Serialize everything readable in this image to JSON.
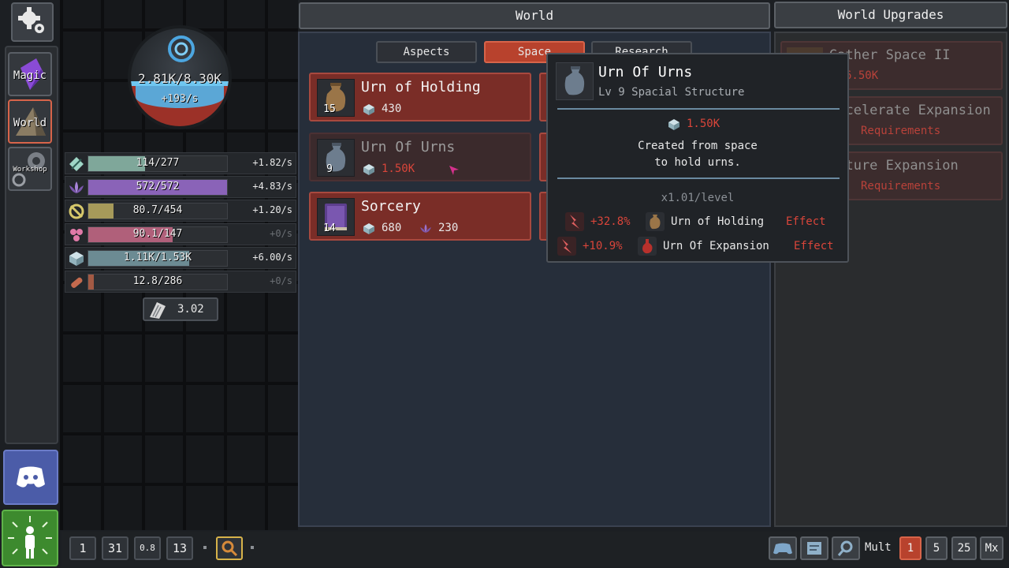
{
  "sidebar": {
    "magic_label": "Magic",
    "world_label": "World",
    "workshop_label": "Workshop"
  },
  "orb": {
    "value": "2.81K/8.30K",
    "rate": "+193/s"
  },
  "resources": [
    {
      "icon": "leaf-icon",
      "value": "114/277",
      "rate": "+1.82/s",
      "fill": 0.41,
      "color": "#7fa79a"
    },
    {
      "icon": "lotus-icon",
      "value": "572/572",
      "rate": "+4.83/s",
      "fill": 1.0,
      "color": "#8a63b8"
    },
    {
      "icon": "swirl-icon",
      "value": "80.7/454",
      "rate": "+1.20/s",
      "fill": 0.18,
      "color": "#a69a5a"
    },
    {
      "icon": "heart-icon",
      "value": "90.1/147",
      "rate": "+0/s",
      "fill": 0.61,
      "color": "#b0607a"
    },
    {
      "icon": "cube-icon",
      "value": "1.11K/1.53K",
      "rate": "+6.00/s",
      "fill": 0.73,
      "color": "#6c8b93"
    },
    {
      "icon": "log-icon",
      "value": "12.8/286",
      "rate": "+0/s",
      "fill": 0.04,
      "color": "#a35a44"
    }
  ],
  "scroll_count": "3.02",
  "headers": {
    "world": "World",
    "upgrades": "World Upgrades"
  },
  "tabs": [
    "Aspects",
    "Space",
    "Research"
  ],
  "cards": [
    {
      "name": "Urn of Holding",
      "level": "15",
      "cost": "430"
    },
    {
      "name": "Urn Of Urns",
      "level": "9",
      "cost": "1.50K"
    },
    {
      "name": "Sorcery",
      "level": "14",
      "cost": "680",
      "cost2": "230"
    }
  ],
  "upgrades": [
    {
      "name": "Gather Space II",
      "sub": "6.50K"
    },
    {
      "name": "Accelerate Expansion",
      "sub": "Requirements"
    },
    {
      "name": "Future Expansion",
      "sub": "Requirements"
    }
  ],
  "tooltip": {
    "title": "Urn Of Urns",
    "subtitle": "Lv 9 Spacial Structure",
    "cost": "1.50K",
    "desc_line1": "Created from space",
    "desc_line2": "to hold urns.",
    "scaling": "x1.01/level",
    "effects": [
      {
        "pct": "+32.8%",
        "target": "Urn of Holding",
        "kind": "Effect"
      },
      {
        "pct": "+10.9%",
        "target": "Urn Of Expansion",
        "kind": "Effect"
      }
    ]
  },
  "bottom": {
    "slots": [
      "1",
      "31",
      "0.8",
      "13"
    ],
    "mult_label": "Mult",
    "mult_options": [
      "1",
      "5",
      "25",
      "Mx"
    ]
  },
  "colors": {
    "accent": "#b8422d",
    "warn": "#d9453a",
    "bar_border": "#6fc6f0"
  }
}
